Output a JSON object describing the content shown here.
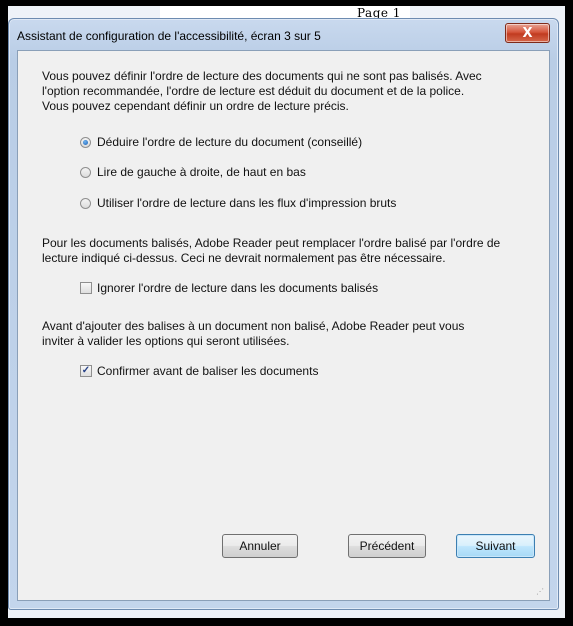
{
  "background_page": {
    "text": "Page 1"
  },
  "window": {
    "title": "Assistant de configuration de l'accessibilité, écran 3 sur 5",
    "close_label": "X"
  },
  "intro": {
    "lines": [
      "Vous pouvez définir l'ordre de lecture des documents qui ne sont pas balisés. Avec",
      "l'option recommandée, l'ordre de lecture est déduit du document et de la police.",
      "Vous pouvez cependant définir un ordre de lecture précis."
    ]
  },
  "reading_order_options": [
    {
      "label": "Déduire l'ordre de lecture du document (conseillé)",
      "selected": true
    },
    {
      "label": "Lire de gauche à droite, de haut en bas",
      "selected": false
    },
    {
      "label": "Utiliser l'ordre de lecture dans les flux d'impression bruts",
      "selected": false
    }
  ],
  "tagged": {
    "lines": [
      "Pour les documents balisés, Adobe Reader peut remplacer l'ordre balisé par l'ordre de",
      "lecture indiqué ci-dessus. Ceci ne devrait normalement pas être nécessaire."
    ],
    "checkbox_label": "Ignorer l'ordre de lecture dans les documents balisés",
    "checked": false
  },
  "untagged": {
    "lines": [
      "Avant d'ajouter des balises à un document non balisé, Adobe Reader peut vous",
      "inviter à valider les options qui seront utilisées."
    ],
    "checkbox_label": "Confirmer avant de baliser les documents",
    "checked": true
  },
  "buttons": {
    "cancel": "Annuler",
    "previous": "Précédent",
    "next": "Suivant"
  }
}
